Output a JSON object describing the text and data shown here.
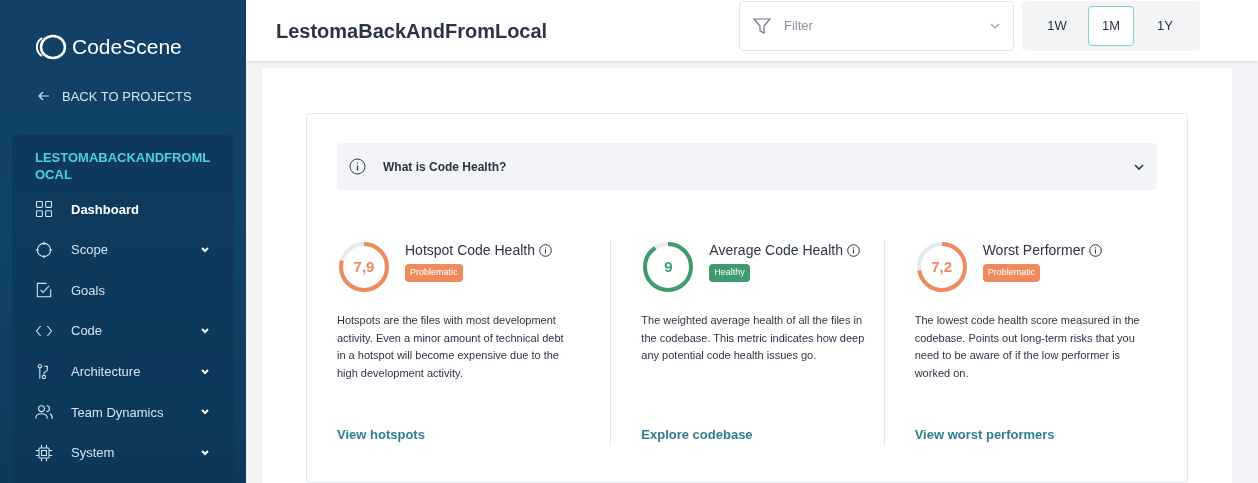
{
  "sidebar": {
    "brand": "CodeScene",
    "back_link": "BACK TO PROJECTS",
    "project": "LESTOMABACKANDFROMLOCAL",
    "items": [
      {
        "label": "Dashboard",
        "kind": "dashboard",
        "selected": true,
        "expandable": false
      },
      {
        "label": "Scope",
        "kind": "scope",
        "selected": false,
        "expandable": true
      },
      {
        "label": "Goals",
        "kind": "goals",
        "selected": false,
        "expandable": false
      },
      {
        "label": "Code",
        "kind": "code",
        "selected": false,
        "expandable": true
      },
      {
        "label": "Architecture",
        "kind": "architecture",
        "selected": false,
        "expandable": true
      },
      {
        "label": "Team Dynamics",
        "kind": "team",
        "selected": false,
        "expandable": true
      },
      {
        "label": "System",
        "kind": "system",
        "selected": false,
        "expandable": true
      }
    ]
  },
  "header": {
    "title": "LestomaBackAndFromLocal",
    "filter": {
      "placeholder": "Filter"
    },
    "ranges": [
      {
        "label": "1W",
        "selected": false
      },
      {
        "label": "1M",
        "selected": true
      },
      {
        "label": "1Y",
        "selected": false
      }
    ]
  },
  "accordion": {
    "title": "What is Code Health?",
    "expanded": false
  },
  "metrics": [
    {
      "title": "Hotspot Code Health",
      "score": "7,9",
      "color": "#ee8a5d",
      "badge": "Problematic",
      "description": "Hotspots are the files with most development activity. Even a minor amount of technical debt in a hotspot will become expensive due to the high development activity.",
      "link": "View hotspots"
    },
    {
      "title": "Average Code Health",
      "score": "9",
      "color": "#3f9a6e",
      "badge": "Healthy",
      "description": "The weighted average health of all the files in the codebase. This metric indicates how deep any potential code health issues go.",
      "link": "Explore codebase"
    },
    {
      "title": "Worst Performer",
      "score": "7,2",
      "color": "#ee8a5d",
      "badge": "Problematic",
      "description": "The lowest code health score measured in the codebase. Points out long-term risks that you need to be aware of if the low performer is worked on.",
      "link": "View worst performers"
    }
  ]
}
